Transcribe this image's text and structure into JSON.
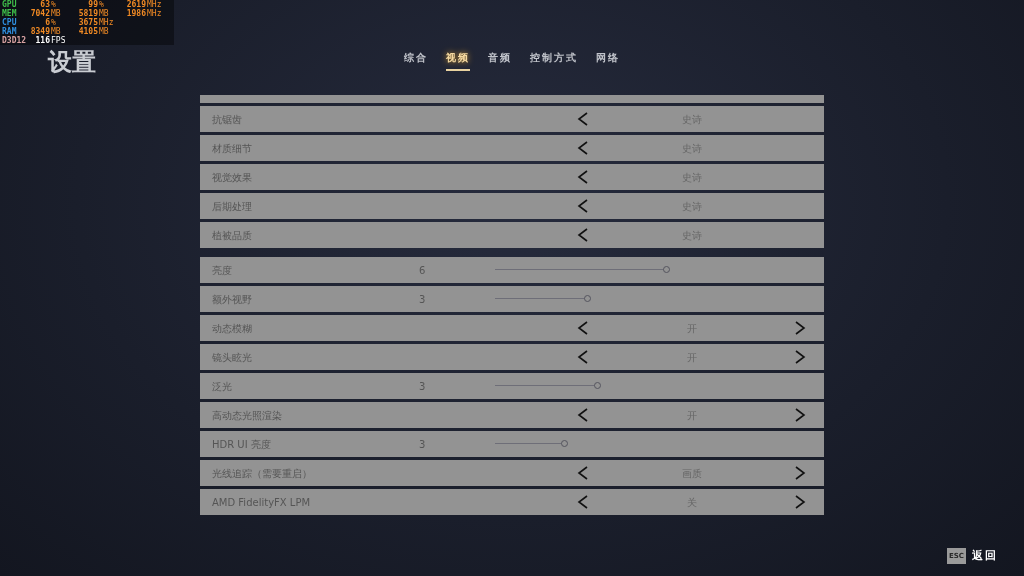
{
  "overlay": [
    {
      "label": "GPU",
      "color": "#3fbf4a",
      "values": [
        {
          "value": "63",
          "unit": "%",
          "emphasis": false
        },
        {
          "value": "99",
          "unit": "%",
          "emphasis": false
        },
        {
          "value": "2619",
          "unit": "MHz",
          "emphasis": false
        }
      ]
    },
    {
      "label": "MEM",
      "color": "#3fbf4a",
      "values": [
        {
          "value": "7042",
          "unit": "MB",
          "emphasis": false
        },
        {
          "value": "5819",
          "unit": "MB",
          "emphasis": false
        },
        {
          "value": "1986",
          "unit": "MHz",
          "emphasis": false
        }
      ]
    },
    {
      "label": "CPU",
      "color": "#2f8fe0",
      "values": [
        {
          "value": "6",
          "unit": "%",
          "emphasis": false
        },
        {
          "value": "3675",
          "unit": "MHz",
          "emphasis": false
        }
      ]
    },
    {
      "label": "RAM",
      "color": "#2f8fe0",
      "values": [
        {
          "value": "8349",
          "unit": "MB",
          "emphasis": false
        },
        {
          "value": "4105",
          "unit": "MB",
          "emphasis": false
        }
      ]
    },
    {
      "label": "D3D12",
      "color": "#d9a3a3",
      "values": [
        {
          "value": "116",
          "unit": "FPS",
          "emphasis": true
        }
      ]
    }
  ],
  "title": "设置",
  "tabs": [
    {
      "label": "综合",
      "selected": false
    },
    {
      "label": "视频",
      "selected": true
    },
    {
      "label": "音频",
      "selected": false
    },
    {
      "label": "控制方式",
      "selected": false
    },
    {
      "label": "网络",
      "selected": false
    }
  ],
  "groups": [
    {
      "rows": [
        {
          "kind": "choice",
          "label": "抗锯齿",
          "value": "史诗",
          "can_increase": false
        },
        {
          "kind": "choice",
          "label": "材质细节",
          "value": "史诗",
          "can_increase": false
        },
        {
          "kind": "choice",
          "label": "视觉效果",
          "value": "史诗",
          "can_increase": false
        },
        {
          "kind": "choice",
          "label": "后期处理",
          "value": "史诗",
          "can_increase": false
        },
        {
          "kind": "choice",
          "label": "植被品质",
          "value": "史诗",
          "can_increase": false
        }
      ]
    },
    {
      "rows": [
        {
          "kind": "slider",
          "label": "亮度",
          "value": "6",
          "level": 0.67
        },
        {
          "kind": "slider",
          "label": "额外视野",
          "value": "3",
          "level": 0.36
        },
        {
          "kind": "choice",
          "label": "动态模糊",
          "value": "开",
          "can_increase": true
        },
        {
          "kind": "choice",
          "label": "镜头眩光",
          "value": "开",
          "can_increase": true
        },
        {
          "kind": "slider",
          "label": "泛光",
          "value": "3",
          "level": 0.4
        },
        {
          "kind": "choice",
          "label": "高动态光照渲染",
          "value": "开",
          "can_increase": true
        },
        {
          "kind": "slider",
          "label": "HDR UI 亮度",
          "value": "3",
          "level": 0.27
        },
        {
          "kind": "choice",
          "label": "光线追踪（需要重启）",
          "value": "画质",
          "can_increase": true
        },
        {
          "kind": "choice",
          "label": "AMD FidelityFX LPM",
          "value": "关",
          "can_increase": true
        }
      ]
    }
  ],
  "footer": {
    "key": "ESC",
    "label": "返回"
  }
}
